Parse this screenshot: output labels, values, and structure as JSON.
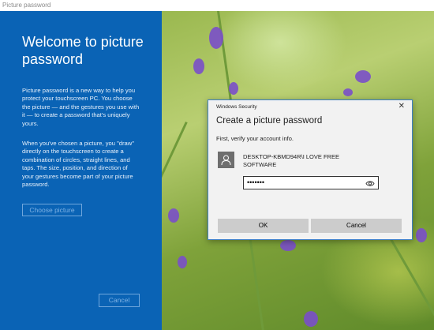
{
  "window": {
    "title": "Picture password"
  },
  "left": {
    "title": "Welcome to picture password",
    "paragraph1": "Picture password is a new way to help you protect your touchscreen PC. You choose the picture — and the gestures you use with it — to create a password that's uniquely yours.",
    "paragraph2": "When you've chosen a picture, you \"draw\" directly on the touchscreen to create a combination of circles, straight lines, and taps. The size, position, and direction of your gestures become part of your picture password.",
    "choose_button": "Choose picture",
    "cancel_button": "Cancel"
  },
  "dialog": {
    "caption": "Windows Security",
    "close": "✕",
    "heading": "Create a picture password",
    "subtitle": "First, verify your account info.",
    "account": "DESKTOP-KBMD94R\\I LOVE FREE SOFTWARE",
    "password_value": "•••••••",
    "ok_button": "OK",
    "cancel_button": "Cancel"
  },
  "icons": {
    "avatar": "user-icon",
    "reveal": "eye-icon"
  },
  "colors": {
    "panel_blue": "#0a63b5",
    "dialog_border": "#3d7fc6"
  }
}
